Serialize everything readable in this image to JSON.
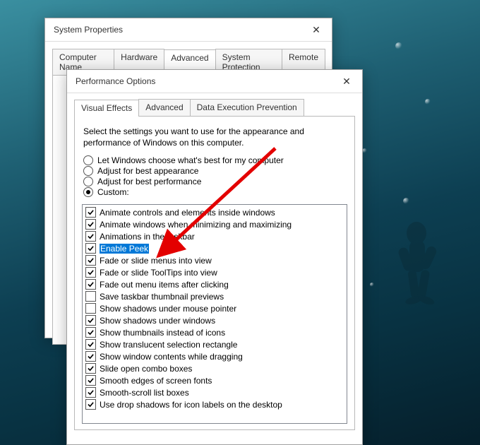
{
  "sysprop": {
    "title": "System Properties",
    "tabs": [
      "Computer Name",
      "Hardware",
      "Advanced",
      "System Protection",
      "Remote"
    ],
    "active_tab": 2
  },
  "perfopt": {
    "title": "Performance Options",
    "tabs": [
      "Visual Effects",
      "Advanced",
      "Data Execution Prevention"
    ],
    "active_tab": 0,
    "description": "Select the settings you want to use for the appearance and performance of Windows on this computer.",
    "radios": [
      {
        "label": "Let Windows choose what's best for my computer",
        "selected": false
      },
      {
        "label": "Adjust for best appearance",
        "selected": false
      },
      {
        "label": "Adjust for best performance",
        "selected": false
      },
      {
        "label": "Custom:",
        "selected": true
      }
    ],
    "checks": [
      {
        "label": "Animate controls and elements inside windows",
        "checked": true
      },
      {
        "label": "Animate windows when minimizing and maximizing",
        "checked": true
      },
      {
        "label": "Animations in the taskbar",
        "checked": true
      },
      {
        "label": "Enable Peek",
        "checked": true,
        "hl": true
      },
      {
        "label": "Fade or slide menus into view",
        "checked": true
      },
      {
        "label": "Fade or slide ToolTips into view",
        "checked": true
      },
      {
        "label": "Fade out menu items after clicking",
        "checked": true
      },
      {
        "label": "Save taskbar thumbnail previews",
        "checked": false
      },
      {
        "label": "Show shadows under mouse pointer",
        "checked": false
      },
      {
        "label": "Show shadows under windows",
        "checked": true
      },
      {
        "label": "Show thumbnails instead of icons",
        "checked": true
      },
      {
        "label": "Show translucent selection rectangle",
        "checked": true
      },
      {
        "label": "Show window contents while dragging",
        "checked": true
      },
      {
        "label": "Slide open combo boxes",
        "checked": true
      },
      {
        "label": "Smooth edges of screen fonts",
        "checked": true
      },
      {
        "label": "Smooth-scroll list boxes",
        "checked": true
      },
      {
        "label": "Use drop shadows for icon labels on the desktop",
        "checked": true
      }
    ]
  }
}
